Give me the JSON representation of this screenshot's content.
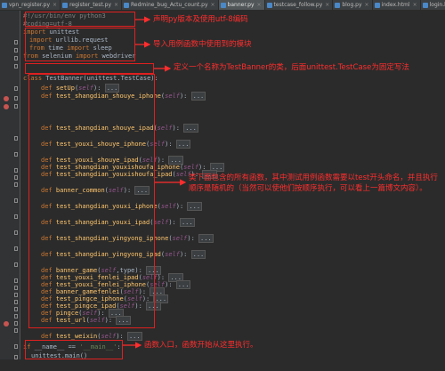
{
  "tabs": [
    {
      "label": "vpn_register.py",
      "active": false
    },
    {
      "label": "register_test.py",
      "active": false
    },
    {
      "label": "Redmine_bug_Actu_count.py",
      "active": false
    },
    {
      "label": "banner.py",
      "active": true
    },
    {
      "label": "testcase_follow.py",
      "active": false
    },
    {
      "label": "blog.py",
      "active": false
    },
    {
      "label": "index.html",
      "active": false
    },
    {
      "label": "login.html",
      "active": false
    }
  ],
  "code": {
    "l1": "#!/usr/bin/env python3",
    "l2": "#coding=utf-8",
    "l3_kw": "import",
    "l3": " unittest",
    "l4_kw": "import",
    "l4": " urllib.request",
    "l5_kw1": "from",
    "l5_mod": " time ",
    "l5_kw2": "import",
    "l5": " sleep",
    "l6_kw1": "from",
    "l6_mod": " selenium ",
    "l6_kw2": "import",
    "l6": " webdriver",
    "class_kw": "class",
    "class_rest": " TestBanner(unittest.TestCase):",
    "def": "def",
    "self": "self",
    "dots": "...",
    "methods": [
      "setUp",
      "test_shangdian_shouye_iphone",
      "test_shangdian_shouye_ipad",
      "test_youxi_shouye_iphone",
      "test_youxi_shouye_ipad",
      "test_shangdian_youxishoufa_iphone",
      "test_shangdian_youxishoufa_ipad",
      "banner_common",
      "test_shangdian_youxi_iphone",
      "test_shangdian_youxi_ipad",
      "test_shangdian_yingyong_iphone",
      "test_shangdian_yingyong_ipad",
      "banner_game",
      "test_youxi_fenlei_ipad",
      "test_youxi_fenlei_iphone",
      "banner_gamefenlei",
      "test_pingce_iphone",
      "test_pingce_ipad",
      "pingce",
      "test_url",
      "test_weixin"
    ],
    "banner_game_extra": ",type",
    "main_if": "if",
    "main_name": " __name__ ",
    "main_eq": "== ",
    "main_str": "'__main__'",
    "main_colon": ":",
    "main_call": "unittest.main()"
  },
  "annotations": {
    "a1": "声明py版本及使用utf-8编码",
    "a2": "导入用例函数中使用到的模块",
    "a3": "定义一个名称为TestBanner的类，后面unittest.TestCase为固定写法",
    "a4": "类下面包含的所有函数，其中测试用例函数需要以test开头命名，并且执行顺序是随机的（当然可以使他们按顺序执行，可以看上一篇博文内容）。",
    "a5": "函数入口，函数开始从这里执行。"
  },
  "colors": {
    "annotation": "#ff2d2d",
    "editor_bg": "#2b2b2b",
    "keyword": "#cc7832",
    "function": "#ffc66d"
  }
}
